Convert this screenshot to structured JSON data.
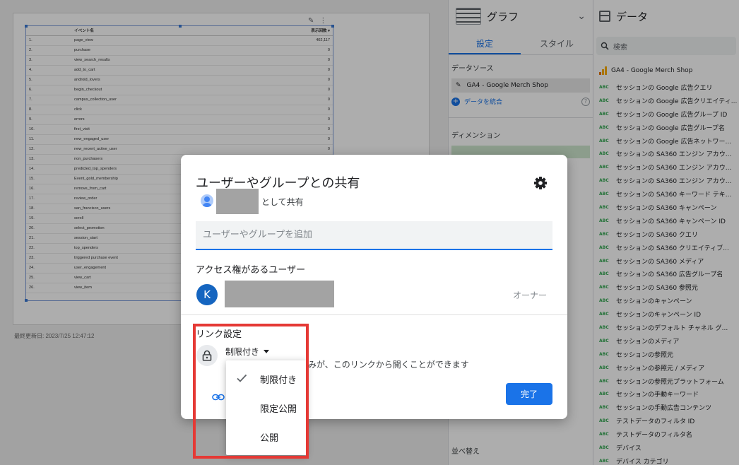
{
  "canvas": {
    "last_updated": "最終更新日: 2023/7/25 12:47:12",
    "table": {
      "col_event": "イベント名",
      "col_count": "表示回数 ▾",
      "rows": [
        {
          "idx": "1.",
          "name": "page_view",
          "value": "402,117"
        },
        {
          "idx": "2.",
          "name": "purchase",
          "value": "0"
        },
        {
          "idx": "3.",
          "name": "view_search_results",
          "value": "0"
        },
        {
          "idx": "4.",
          "name": "add_to_cart",
          "value": "0"
        },
        {
          "idx": "5.",
          "name": "android_lovers",
          "value": "0"
        },
        {
          "idx": "6.",
          "name": "begin_checkout",
          "value": "0"
        },
        {
          "idx": "7.",
          "name": "campus_collection_user",
          "value": "0"
        },
        {
          "idx": "8.",
          "name": "click",
          "value": "0"
        },
        {
          "idx": "9.",
          "name": "errors",
          "value": "0"
        },
        {
          "idx": "10.",
          "name": "first_visit",
          "value": "0"
        },
        {
          "idx": "11.",
          "name": "new_engaged_user",
          "value": "0"
        },
        {
          "idx": "12.",
          "name": "new_recent_active_user",
          "value": "0"
        },
        {
          "idx": "13.",
          "name": "non_purchasers",
          "value": ""
        },
        {
          "idx": "14.",
          "name": "predicted_top_spenders",
          "value": ""
        },
        {
          "idx": "15.",
          "name": "Event_gold_membership",
          "value": ""
        },
        {
          "idx": "16.",
          "name": "remove_from_cart",
          "value": ""
        },
        {
          "idx": "17.",
          "name": "review_order",
          "value": ""
        },
        {
          "idx": "18.",
          "name": "san_francisco_users",
          "value": ""
        },
        {
          "idx": "19.",
          "name": "scroll",
          "value": ""
        },
        {
          "idx": "20.",
          "name": "select_promotion",
          "value": ""
        },
        {
          "idx": "21.",
          "name": "session_start",
          "value": ""
        },
        {
          "idx": "22.",
          "name": "top_spenders",
          "value": ""
        },
        {
          "idx": "23.",
          "name": "triggered purchase event",
          "value": ""
        },
        {
          "idx": "24.",
          "name": "user_engagement",
          "value": ""
        },
        {
          "idx": "25.",
          "name": "view_cart",
          "value": ""
        },
        {
          "idx": "26.",
          "name": "view_item",
          "value": ""
        }
      ]
    }
  },
  "props": {
    "chart_label": "グラフ",
    "tabs": [
      "設定",
      "スタイル"
    ],
    "datasource_heading": "データソース",
    "datasource_name": "GA4 - Google Merch Shop",
    "blend_label": "データを統合",
    "dimension_heading": "ディメンション",
    "sort_heading": "並べ替え"
  },
  "data_panel": {
    "title": "データ",
    "search_placeholder": "検索",
    "source": "GA4 - Google Merch Shop",
    "field_type": "ABC",
    "fields": [
      "セッションの Google 広告クエリ",
      "セッションの Google 広告クリエイティ...",
      "セッションの Google 広告グループ ID",
      "セッションの Google 広告グループ名",
      "セッションの Google 広告ネットワー...",
      "セッションの SA360 エンジン アカウ...",
      "セッションの SA360 エンジン アカウ...",
      "セッションの SA360 エンジン アカウ...",
      "セッションの SA360 キーワード テキ...",
      "セッションの SA360 キャンペーン",
      "セッションの SA360 キャンペーン ID",
      "セッションの SA360 クエリ",
      "セッションの SA360 クリエイティブ...",
      "セッションの SA360 メディア",
      "セッションの SA360 広告グループ名",
      "セッションの SA360 参照元",
      "セッションのキャンペーン",
      "セッションのキャンペーン ID",
      "セッションのデフォルト チャネル グ...",
      "セッションのメディア",
      "セッションの参照元",
      "セッションの参照元 / メディア",
      "セッションの参照元プラットフォーム",
      "セッションの手動キーワード",
      "セッションの手動広告コンテンツ",
      "テストデータのフィルタ ID",
      "テストデータのフィルタ名",
      "デバイス",
      "デバイス カテゴリ"
    ]
  },
  "dialog": {
    "title": "ユーザーやグループとの共有",
    "shared_as": "として共有",
    "add_placeholder": "ユーザーやグループを追加",
    "access_heading": "アクセス権があるユーザー",
    "user_initial": "K",
    "owner_role": "オーナー",
    "link_heading": "リンク設定",
    "link_mode": "制限付き",
    "link_description": "みが、このリンクから開くことができます",
    "done_label": "完了",
    "menu": [
      "制限付き",
      "限定公開",
      "公開"
    ]
  },
  "colors": {
    "accent": "#1a73e8",
    "highlight": "#e53935",
    "field_type": "#34a853"
  }
}
